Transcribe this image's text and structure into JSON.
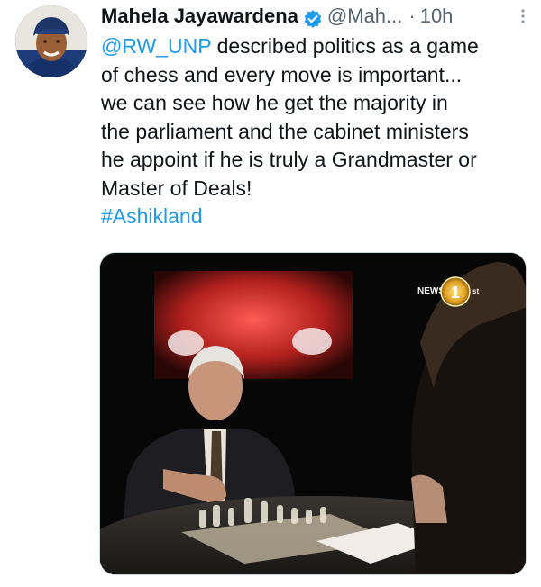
{
  "tweet": {
    "author_name": "Mahela Jayawardena",
    "author_handle": "@Mah...",
    "separator": "·",
    "time": "10h",
    "more_icon": "more-vertical-icon",
    "verified_icon": "verified-badge-icon",
    "text_lines": [
      {
        "mention": "@RW_UNP",
        "rest": " described politics as a game"
      },
      "of chess and every move is important...",
      "we can see how he get the majority in",
      "the parliament and the cabinet ministers",
      "he appoint if he is truly a Grandmaster or",
      "Master of Deals!"
    ],
    "hashtag": "#Ashikland",
    "media": {
      "logo_text": "NEWS",
      "logo_number": "1",
      "logo_suffix": "st"
    }
  },
  "colors": {
    "link": "#1d9bf0",
    "text": "#0f1419",
    "muted": "#536471",
    "verified": "#1d9bf0"
  }
}
